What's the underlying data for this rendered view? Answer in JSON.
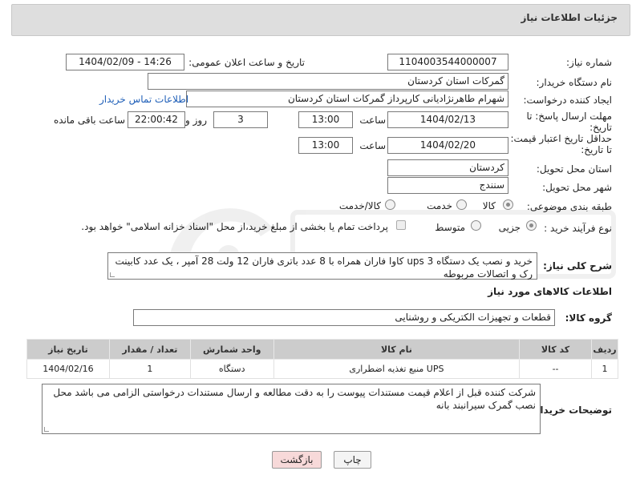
{
  "header": {
    "title": "جزئیات اطلاعات نیاز"
  },
  "fields": {
    "need_number_label": "شماره نیاز:",
    "need_number": "1104003544000007",
    "announce_label": "تاریخ و ساعت اعلان عمومی:",
    "announce_value": "1404/02/09 - 14:26",
    "buyer_org_label": "نام دستگاه خریدار:",
    "buyer_org": "گمرکات استان کردستان",
    "requester_label": "ایجاد کننده درخواست:",
    "requester": "شهرام  طاهرنژادیانی کارپرداز گمرکات استان کردستان",
    "contact_link": "اطلاعات تماس خریدار",
    "deadline_label_1": "مهلت ارسال پاسخ: تا",
    "deadline_label_2": "تاریخ:",
    "deadline_date": "1404/02/13",
    "time_label": "ساعت",
    "deadline_time": "13:00",
    "days_value": "3",
    "days_label": "روز و",
    "remaining_time": "22:00:42",
    "remaining_label": "ساعت باقی مانده",
    "validity_label_1": "حداقل تاریخ اعتبار قیمت:",
    "validity_label_2": "تا تاریخ:",
    "validity_date": "1404/02/20",
    "validity_time": "13:00",
    "province_label": "استان محل تحویل:",
    "province": "کردستان",
    "city_label": "شهر محل تحویل:",
    "city": "سنندج",
    "category_label": "طبقه بندی موضوعی:",
    "category_options": [
      "کالا",
      "خدمت",
      "کالا/خدمت"
    ],
    "category_selected": "کالا",
    "process_label": "نوع فرآیند خرید :",
    "process_options": [
      "جزیی",
      "متوسط"
    ],
    "process_selected": "جزیی",
    "payment_note": "پرداخت تمام یا بخشی از مبلغ خرید،از محل \"اسناد خزانه اسلامی\" خواهد بود."
  },
  "description": {
    "label": "شرح کلی نیاز:",
    "text": "خرید و نصب یک دستگاه ups 3 کاوا فاران همراه با 8 عدد باتری فاران 12  ولت 28 آمپر ، یک عدد کابینت رک و اتصالات مربوطه"
  },
  "goods": {
    "section_title": "اطلاعات کالاهای مورد نیاز",
    "group_label": "گروه کالا:",
    "group_value": "قطعات و تجهیزات الکتریکی و روشنایی",
    "columns": [
      "ردیف",
      "کد کالا",
      "نام کالا",
      "واحد شمارش",
      "تعداد / مقدار",
      "تاریخ نیاز"
    ],
    "rows": [
      {
        "row": "1",
        "code": "--",
        "name": "منبع تغذیه اضطراری UPS",
        "unit": "دستگاه",
        "qty": "1",
        "date": "1404/02/16"
      }
    ]
  },
  "buyer_notes": {
    "label": "توضیحات خریدار:",
    "text": "شرکت کننده قبل از اعلام قیمت مستندات پیوست را به دقت مطالعه و ارسال مستندات درخواستی الزامی می باشد محل نصب گمرک سیرانبند بانه"
  },
  "buttons": {
    "print": "چاپ",
    "back": "بازگشت"
  },
  "colors": {
    "header_bg": "#dedede",
    "table_header_bg": "#cccccc",
    "back_button_bg": "#f7d9d9",
    "link": "#1f5fb8"
  }
}
